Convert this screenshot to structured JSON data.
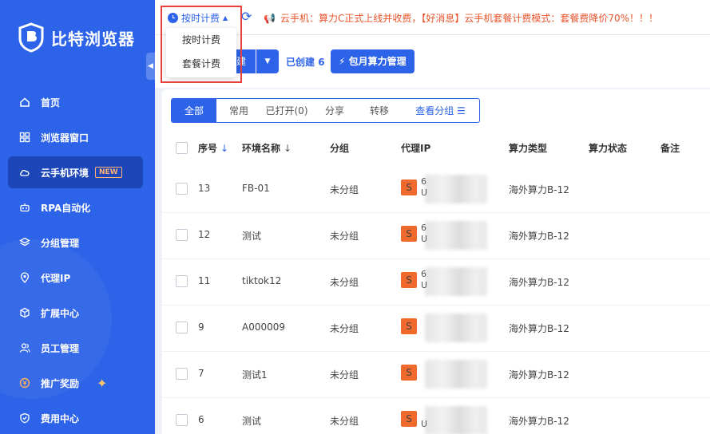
{
  "app": {
    "name": "比特浏览器",
    "collapse_glyph": "◀"
  },
  "sidebar": {
    "items": [
      {
        "label": "首页",
        "icon": "home-icon"
      },
      {
        "label": "浏览器窗口",
        "icon": "grid-icon"
      },
      {
        "label": "云手机环境",
        "icon": "cloud-icon",
        "badge": "NEW",
        "active": true
      },
      {
        "label": "RPA自动化",
        "icon": "robot-icon"
      },
      {
        "label": "分组管理",
        "icon": "layers-icon"
      },
      {
        "label": "代理IP",
        "icon": "location-icon"
      },
      {
        "label": "扩展中心",
        "icon": "cube-icon"
      },
      {
        "label": "员工管理",
        "icon": "users-icon"
      },
      {
        "label": "推广奖励",
        "icon": "coin-icon",
        "sparkle": "✦"
      },
      {
        "label": "费用中心",
        "icon": "shield-icon"
      }
    ]
  },
  "topbar": {
    "billing_mode": "按时计费",
    "billing_caret": "▲",
    "refresh_glyph": "⟳",
    "megaphone_glyph": "📢",
    "notice": "云手机：算力C正式上线并收费，【好消息】云手机套餐计费模式：套餐费降价70%！！！"
  },
  "dropdown": {
    "options": [
      "按时计费",
      "套餐计费"
    ]
  },
  "toolbar": {
    "main_button_label": "建",
    "caret_glyph": "▼",
    "created_label": "已创建",
    "created_count": "6",
    "power_glyph": "⚡",
    "power_button_label": "包月算力管理"
  },
  "tabs": [
    {
      "label": "全部",
      "active": true
    },
    {
      "label": "常用"
    },
    {
      "label": "已打开(0)"
    },
    {
      "label": "分享"
    },
    {
      "label": "转移"
    },
    {
      "label": "查看分组 ☰",
      "link": true
    }
  ],
  "table": {
    "headers": {
      "seq": "序号",
      "name": "环境名称",
      "group": "分组",
      "proxy": "代理IP",
      "power_type": "算力类型",
      "power_status": "算力状态",
      "note": "备注"
    },
    "sort_glyph": "↓",
    "rows": [
      {
        "seq": "13",
        "name": "FB-01",
        "group": "未分组",
        "proxy_badge": "S",
        "ip_top": "6",
        "ip_bottom": "U",
        "power_type": "海外算力B-12"
      },
      {
        "seq": "12",
        "name": "测试",
        "group": "未分组",
        "proxy_badge": "S",
        "ip_top": "6",
        "ip_bottom": "U",
        "power_type": "海外算力B-12"
      },
      {
        "seq": "11",
        "name": "tiktok12",
        "group": "未分组",
        "proxy_badge": "S",
        "ip_top": "6",
        "ip_bottom": "U",
        "power_type": "海外算力B-12"
      },
      {
        "seq": "9",
        "name": "A000009",
        "group": "未分组",
        "proxy_badge": "S",
        "ip_top": "",
        "ip_bottom": "",
        "power_type": "海外算力B-12"
      },
      {
        "seq": "7",
        "name": "测试1",
        "group": "未分组",
        "proxy_badge": "S",
        "ip_top": "",
        "ip_bottom": "",
        "power_type": "海外算力B-12"
      },
      {
        "seq": "6",
        "name": "测试",
        "group": "未分组",
        "proxy_badge": "S",
        "ip_top": "",
        "ip_bottom": "U",
        "power_type": "海外算力B-12"
      }
    ]
  },
  "colors": {
    "primary": "#2c63e8",
    "notice": "#e8532a",
    "proxy_badge": "#ef6a2c",
    "highlight": "#e8403f"
  }
}
